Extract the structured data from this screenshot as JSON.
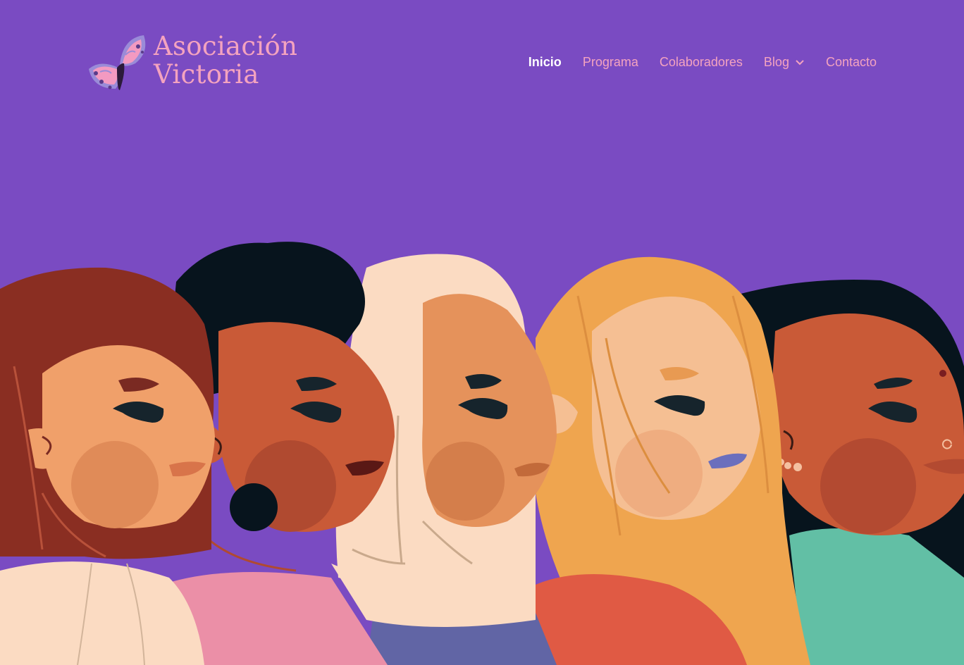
{
  "site": {
    "logo_line1": "Asociación",
    "logo_line2": "Victoria",
    "logo_icon": "butterfly-icon"
  },
  "nav": {
    "items": [
      {
        "label": "Inicio",
        "active": true
      },
      {
        "label": "Programa"
      },
      {
        "label": "Colaboradores"
      },
      {
        "label": "Blog",
        "has_dropdown": true
      },
      {
        "label": "Contacto"
      }
    ],
    "dropdown_icon": "chevron-down-icon"
  },
  "colors": {
    "background": "#7a4bc2",
    "nav_link": "#f4a3bf",
    "nav_active": "#ffffff",
    "logo_text": "#f4a3bf"
  },
  "hero": {
    "illustration": "five-women-profile-illustration"
  }
}
